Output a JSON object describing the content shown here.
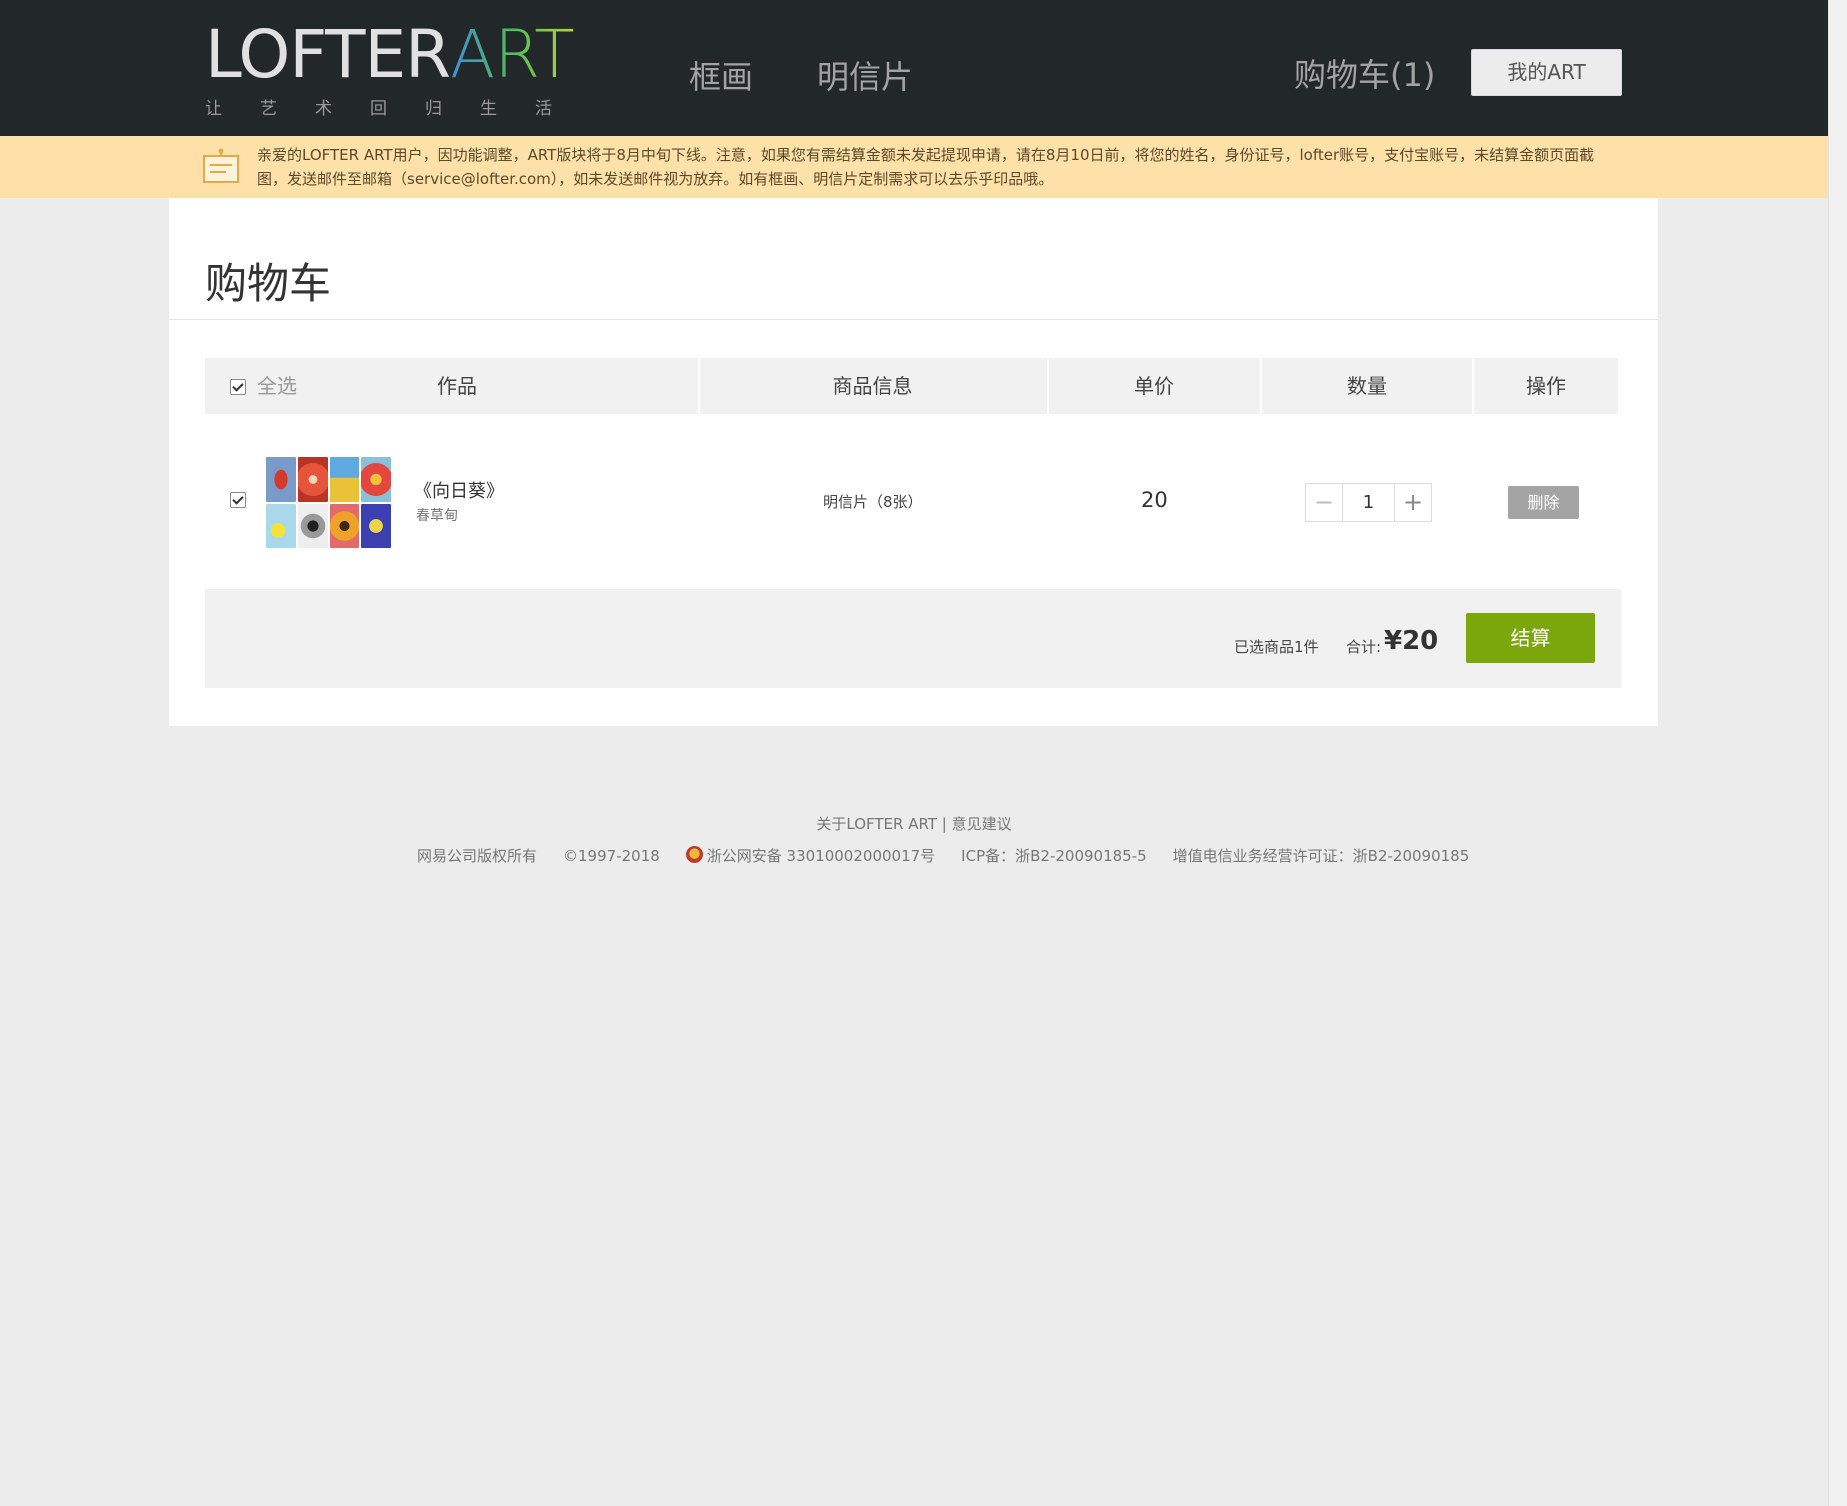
{
  "header": {
    "logo_main": "LOFTER",
    "logo_accent": "ART",
    "logo_slogan": "让艺术回归生活",
    "nav": [
      "框画",
      "明信片"
    ],
    "cart_link": "购物车(1)",
    "my_art_button": "我的ART"
  },
  "notice": {
    "text": "亲爱的LOFTER ART用户，因功能调整，ART版块将于8月中旬下线。注意，如果您有需结算金额未发起提现申请，请在8月10日前，将您的姓名，身份证号，lofter账号，支付宝账号，未结算金额页面截图，发送邮件至邮箱（service@lofter.com），如未发送邮件视为放弃。如有框画、明信片定制需求可以去乐乎印品哦。"
  },
  "page": {
    "title": "购物车"
  },
  "table": {
    "select_all_label": "全选",
    "headers": [
      "作品",
      "商品信息",
      "单价",
      "数量",
      "操作"
    ],
    "rows": [
      {
        "title": "《向日葵》",
        "author": "春草甸",
        "info": "明信片（8张）",
        "price": "20",
        "quantity": "1",
        "delete_label": "删除",
        "checked": true
      }
    ]
  },
  "summary": {
    "selected_count": "已选商品1件",
    "total_label": "合计:",
    "total_value": "¥20",
    "checkout_label": "结算"
  },
  "footer": {
    "about": "关于LOFTER ART",
    "separator": "|",
    "feedback": "意见建议",
    "copyright": "网易公司版权所有",
    "years": "©1997-2018",
    "police_record": "浙公网安备 33010002000017号",
    "icp": "ICP备：浙B2-20090185-5",
    "telecom": "增值电信业务经营许可证：浙B2-20090185"
  },
  "colors": {
    "header_bg": "#22272a",
    "notice_bg": "#fde1a8",
    "checkout_green": "#7ba60c",
    "delete_gray": "#a4a4a4",
    "page_bg": "#ececed"
  }
}
